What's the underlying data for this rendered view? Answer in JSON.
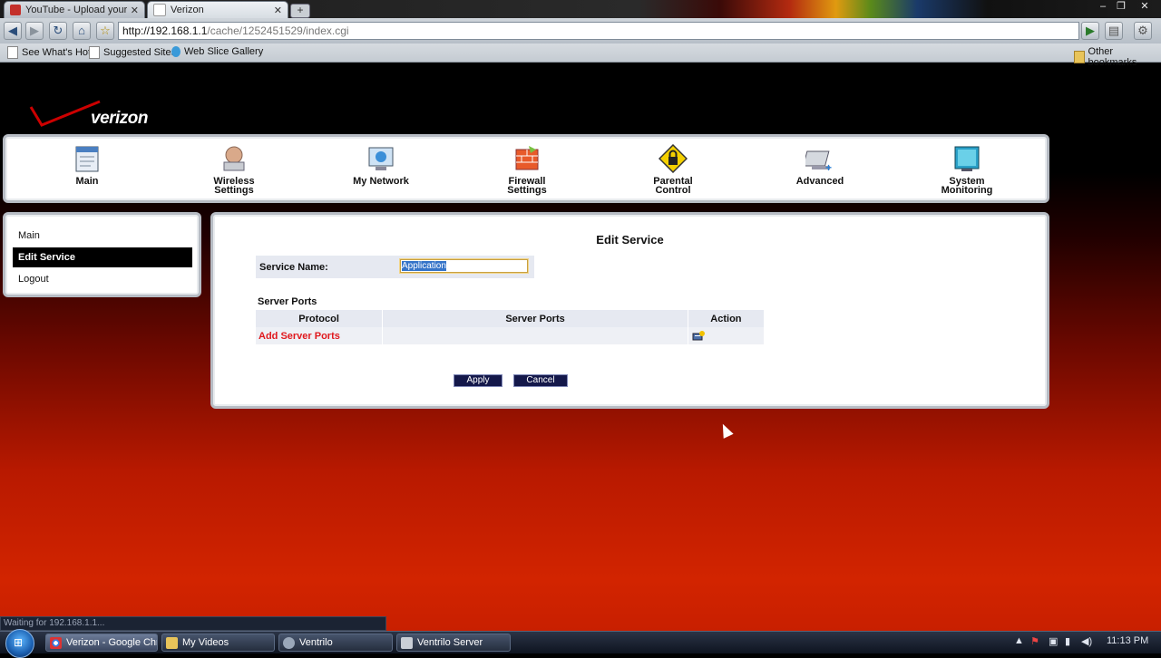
{
  "browser": {
    "tabs": [
      {
        "label": "YouTube - Upload your v...",
        "active": false
      },
      {
        "label": "Verizon",
        "active": true
      }
    ],
    "new_tab": "+",
    "url_host": "http://192.168.1.1",
    "url_path": "/cache/1252451529/index.cgi",
    "bookmarks": [
      "See What's Hot",
      "Suggested Sites",
      "Web Slice Gallery"
    ],
    "other_bookmarks": "Other bookmarks",
    "status_text": "Waiting for 192.168.1.1..."
  },
  "brand": {
    "logo_text": "verizon",
    "logo_color": "#cc0000"
  },
  "topnav": [
    {
      "line1": "Main",
      "line2": "",
      "icon": "main-icon"
    },
    {
      "line1": "Wireless",
      "line2": "Settings",
      "icon": "wireless-icon"
    },
    {
      "line1": "My Network",
      "line2": "",
      "icon": "network-icon"
    },
    {
      "line1": "Firewall",
      "line2": "Settings",
      "icon": "firewall-icon"
    },
    {
      "line1": "Parental",
      "line2": "Control",
      "icon": "parental-lock-icon"
    },
    {
      "line1": "Advanced",
      "line2": "",
      "icon": "advanced-icon"
    },
    {
      "line1": "System",
      "line2": "Monitoring",
      "icon": "monitor-icon"
    }
  ],
  "sidebar": [
    {
      "label": "Main",
      "selected": false
    },
    {
      "label": "Edit Service",
      "selected": true
    },
    {
      "label": "Logout",
      "selected": false
    }
  ],
  "content": {
    "title": "Edit Service",
    "service_name_label": "Service Name:",
    "service_name_value": "Application",
    "section_title": "Server Ports",
    "columns": [
      "Protocol",
      "Server Ports",
      "Action"
    ],
    "add_link": "Add Server Ports",
    "apply_label": "Apply",
    "cancel_label": "Cancel"
  },
  "taskbar": {
    "tasks": [
      {
        "label": "Verizon - Google Chr...",
        "active": true
      },
      {
        "label": "My Videos",
        "active": false
      },
      {
        "label": "Ventrilo",
        "active": false
      },
      {
        "label": "Ventrilo Server",
        "active": false
      }
    ],
    "clock": "11:13 PM"
  }
}
